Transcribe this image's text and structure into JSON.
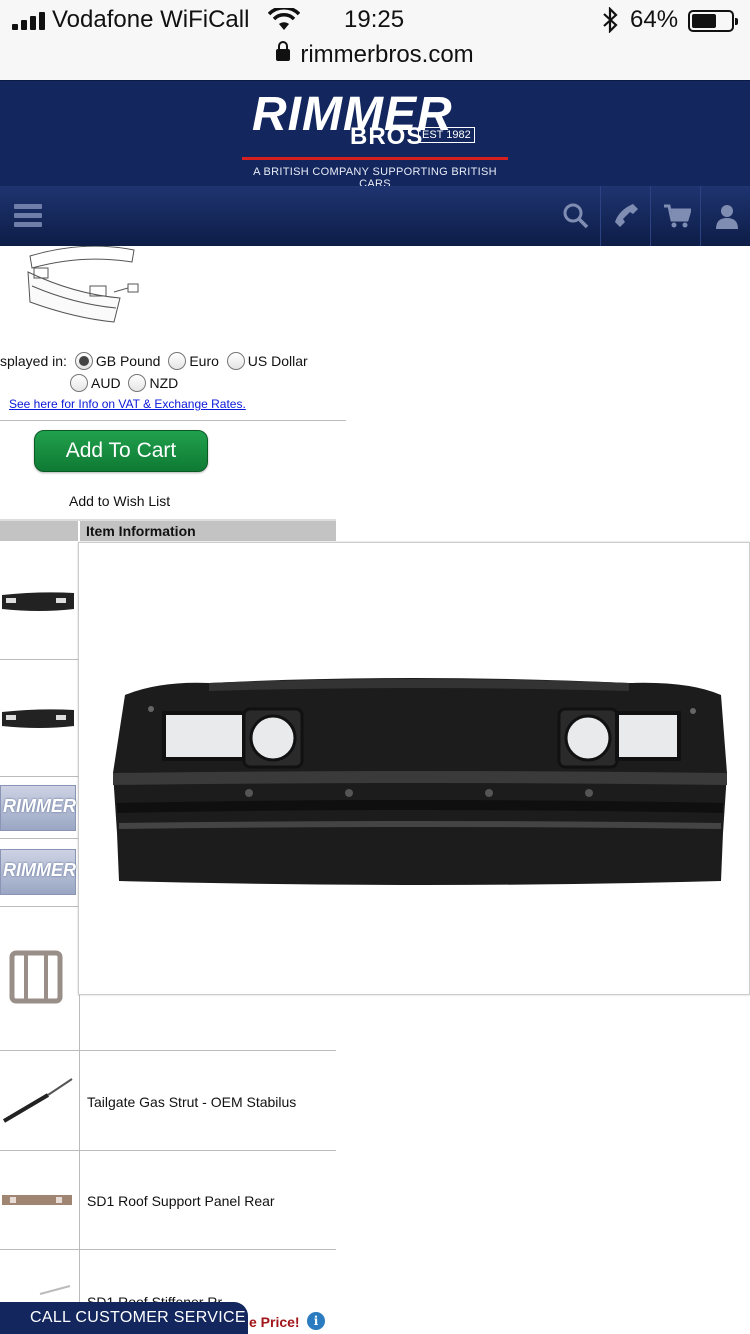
{
  "status_bar": {
    "carrier": "Vodafone WiFiCall",
    "time": "19:25",
    "battery_percent_label": "64%",
    "battery_level": 0.64,
    "signal_bars": 4
  },
  "browser": {
    "url": "rimmerbros.com"
  },
  "header": {
    "logo_main": "RIMMER",
    "logo_sub": "BROS",
    "logo_est": "EST 1982",
    "tagline": "A BRITISH COMPANY SUPPORTING BRITISH CARS",
    "accent_color": "#d6201f",
    "brand_color": "#13275e"
  },
  "nav": {
    "icons": [
      "menu-icon",
      "search-icon",
      "phone-icon",
      "cart-icon",
      "user-icon"
    ]
  },
  "currency": {
    "label": "splayed in:",
    "options": [
      "GB Pound",
      "Euro",
      "US Dollar",
      "AUD",
      "NZD"
    ],
    "selected": "GB Pound",
    "info_link": "See here for Info on VAT & Exchange Rates."
  },
  "actions": {
    "add_to_cart": "Add To Cart",
    "add_to_wish_list": "Add to Wish List"
  },
  "table": {
    "header": "Item Information",
    "rows": [
      {
        "name": "Tailgate Gas Strut - OEM Stabilus"
      },
      {
        "name": "SD1 Roof Support Panel Rear"
      },
      {
        "name": "SD1 Roof Stiffener Rr..."
      }
    ]
  },
  "footer": {
    "call_label": "CALL CUSTOMER SERVICE",
    "price_fragment": "e Price!",
    "info_glyph": "i"
  }
}
